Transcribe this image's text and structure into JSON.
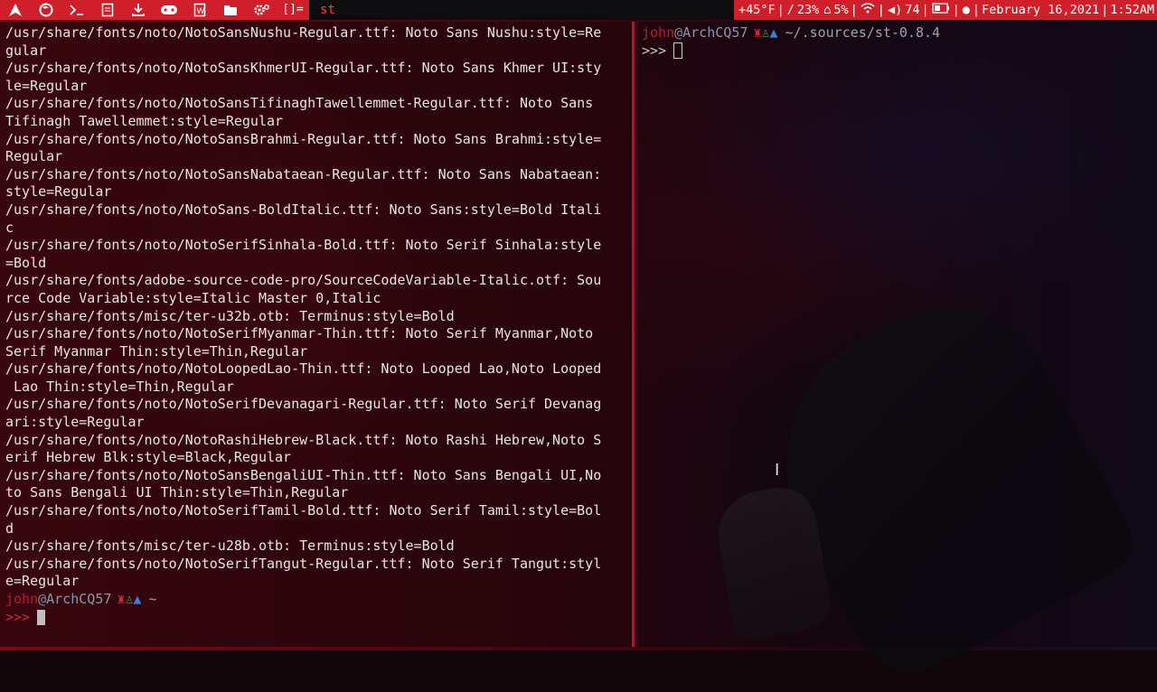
{
  "topbar": {
    "window_title": "st",
    "icons": [
      "arch-logo-icon",
      "firefox-icon",
      "terminal-icon",
      "file-manager-icon",
      "download-icon",
      "gamepad-icon",
      "document-icon",
      "folder-icon",
      "settings-icon"
    ],
    "layout_symbol": "[]=",
    "status": {
      "weather": "+45°F",
      "cpu": "23%",
      "ram": "5%",
      "volume": "74",
      "date": "February 16,2021",
      "time": "1:52AM"
    }
  },
  "left_terminal": {
    "lines": [
      "/usr/share/fonts/noto/NotoSansNushu-Regular.ttf: Noto Sans Nushu:style=Re",
      "gular",
      "/usr/share/fonts/noto/NotoSansKhmerUI-Regular.ttf: Noto Sans Khmer UI:sty",
      "le=Regular",
      "/usr/share/fonts/noto/NotoSansTifinaghTawellemmet-Regular.ttf: Noto Sans",
      "Tifinagh Tawellemmet:style=Regular",
      "/usr/share/fonts/noto/NotoSansBrahmi-Regular.ttf: Noto Sans Brahmi:style=",
      "Regular",
      "/usr/share/fonts/noto/NotoSansNabataean-Regular.ttf: Noto Sans Nabataean:",
      "style=Regular",
      "/usr/share/fonts/noto/NotoSans-BoldItalic.ttf: Noto Sans:style=Bold Itali",
      "c",
      "/usr/share/fonts/noto/NotoSerifSinhala-Bold.ttf: Noto Serif Sinhala:style",
      "=Bold",
      "/usr/share/fonts/adobe-source-code-pro/SourceCodeVariable-Italic.otf: Sou",
      "rce Code Variable:style=Italic Master 0,Italic",
      "/usr/share/fonts/misc/ter-u32b.otb: Terminus:style=Bold",
      "/usr/share/fonts/noto/NotoSerifMyanmar-Thin.ttf: Noto Serif Myanmar,Noto",
      "Serif Myanmar Thin:style=Thin,Regular",
      "/usr/share/fonts/noto/NotoLoopedLao-Thin.ttf: Noto Looped Lao,Noto Looped",
      " Lao Thin:style=Thin,Regular",
      "/usr/share/fonts/noto/NotoSerifDevanagari-Regular.ttf: Noto Serif Devanag",
      "ari:style=Regular",
      "/usr/share/fonts/noto/NotoRashiHebrew-Black.ttf: Noto Rashi Hebrew,Noto S",
      "erif Hebrew Blk:style=Black,Regular",
      "/usr/share/fonts/noto/NotoSansBengaliUI-Thin.ttf: Noto Sans Bengali UI,No",
      "to Sans Bengali UI Thin:style=Thin,Regular",
      "/usr/share/fonts/noto/NotoSerifTamil-Bold.ttf: Noto Serif Tamil:style=Bol",
      "d",
      "/usr/share/fonts/misc/ter-u28b.otb: Terminus:style=Bold",
      "/usr/share/fonts/noto/NotoSerifTangut-Regular.ttf: Noto Serif Tangut:styl",
      "e=Regular"
    ],
    "prompt": {
      "user": "john",
      "at": "@",
      "host": "ArchCQ57",
      "path": "~",
      "arrows": ">>>"
    }
  },
  "right_terminal": {
    "prompt": {
      "user": "john",
      "at": "@",
      "host": "ArchCQ57",
      "path": "~/.sources/st-0.8.4",
      "arrows": ">>>"
    }
  },
  "colors": {
    "accent": "#cf1f2b",
    "prompt_user": "#b81e33",
    "border": "#b5132a"
  }
}
